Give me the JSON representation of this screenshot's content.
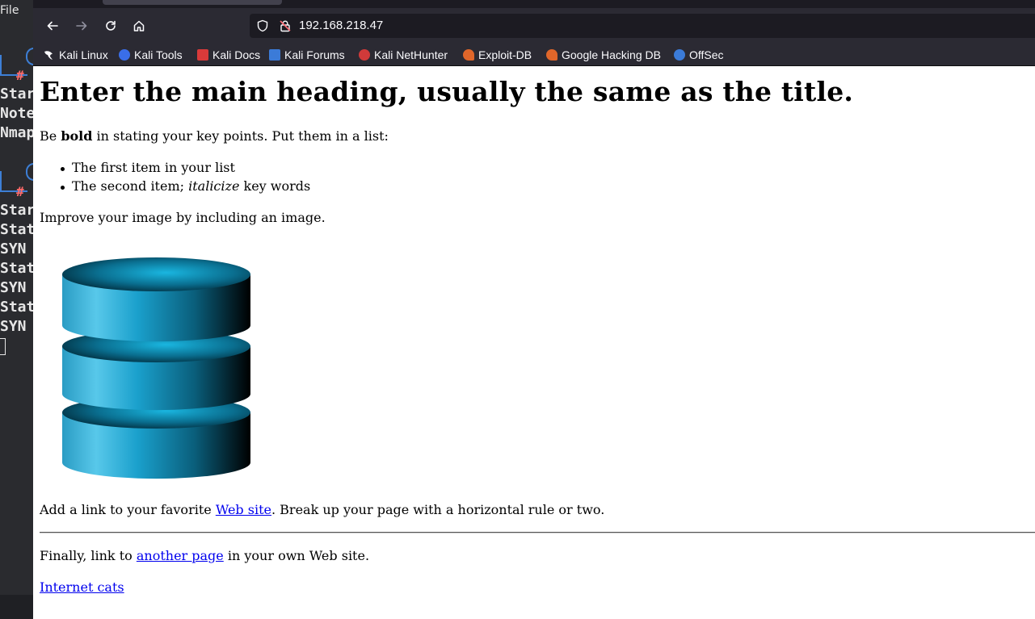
{
  "terminal": {
    "menu_label": "File",
    "lines": [
      "Star",
      "Note",
      "Nmap",
      "Star",
      "Stat",
      "SYN ",
      "Stat",
      "SYN ",
      "Stat",
      "SYN "
    ],
    "prompt_hash": "#"
  },
  "browser": {
    "url": "192.168.218.47",
    "nav": {
      "back_icon": "arrow-left-icon",
      "forward_icon": "arrow-right-icon",
      "reload_icon": "reload-icon",
      "home_icon": "home-icon"
    },
    "bookmarks": [
      {
        "label": "Kali Linux",
        "color": "#2b2a33"
      },
      {
        "label": "Kali Tools",
        "color": "#3a6ee8"
      },
      {
        "label": "Kali Docs",
        "color": "#d93a3a"
      },
      {
        "label": "Kali Forums",
        "color": "#3b7bd8"
      },
      {
        "label": "Kali NetHunter",
        "color": "#d13a3a"
      },
      {
        "label": "Exploit-DB",
        "color": "#e0662a"
      },
      {
        "label": "Google Hacking DB",
        "color": "#e0662a"
      },
      {
        "label": "OffSec",
        "color": "#3b7bd8"
      }
    ]
  },
  "page": {
    "heading": "Enter the main heading, usually the same as the title.",
    "p1_before": "Be ",
    "p1_bold": "bold",
    "p1_after": " in stating your key points. Put them in a list:",
    "list_item1": "The first item in your list",
    "list_item2_before": "The second item; ",
    "list_item2_italic": "italicize",
    "list_item2_after": " key words",
    "p2": "Improve your image by including an image.",
    "p3_before": "Add a link to your favorite ",
    "p3_link": "Web site",
    "p3_after": ". Break up your page with a horizontal rule or two.",
    "p4_before": "Finally, link to ",
    "p4_link": "another page",
    "p4_after": " in your own Web site.",
    "p5_link": "Internet cats"
  }
}
